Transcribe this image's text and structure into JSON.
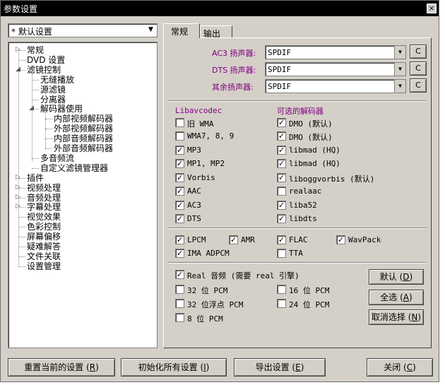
{
  "window": {
    "title": "参数设置",
    "close_glyph": "×"
  },
  "preset": {
    "value": "* 默认设置"
  },
  "tree": [
    {
      "label": "常规"
    },
    {
      "label": "DVD 设置"
    },
    {
      "label": "滤镜控制"
    },
    {
      "label": "无缝播放"
    },
    {
      "label": "源滤镜"
    },
    {
      "label": "分离器"
    },
    {
      "label": "解码器使用"
    },
    {
      "label": "内部视频解码器"
    },
    {
      "label": "外部视频解码器"
    },
    {
      "label": "内部音频解码器"
    },
    {
      "label": "外部音频解码器"
    },
    {
      "label": "多音频流"
    },
    {
      "label": "自定义滤镜管理器"
    },
    {
      "label": "插件"
    },
    {
      "label": "视频处理"
    },
    {
      "label": "音频处理"
    },
    {
      "label": "字幕处理"
    },
    {
      "label": "视觉效果"
    },
    {
      "label": "色彩控制"
    },
    {
      "label": "屏幕偏移"
    },
    {
      "label": "疑难解答"
    },
    {
      "label": "文件关联"
    },
    {
      "label": "设置管理"
    }
  ],
  "tabs": [
    {
      "label": "常规"
    },
    {
      "label": "输出"
    }
  ],
  "splitters": [
    {
      "label": "AC3 扬声器:",
      "value": "SPDIF",
      "button": "C"
    },
    {
      "label": "DTS 扬声器:",
      "value": "SPDIF",
      "button": "C"
    },
    {
      "label": "其余扬声器:",
      "value": "SPDIF",
      "button": "C"
    }
  ],
  "groups": {
    "libavcodec": "Libavcodec",
    "optional": "可选的解码器"
  },
  "left_decoders": [
    {
      "label": "旧 WMA",
      "checked": false
    },
    {
      "label": "WMA7, 8, 9",
      "checked": false
    },
    {
      "label": "MP3",
      "checked": true
    },
    {
      "label": "MP1, MP2",
      "checked": true
    },
    {
      "label": "Vorbis",
      "checked": true
    },
    {
      "label": "AAC",
      "checked": true
    },
    {
      "label": "AC3",
      "checked": true
    },
    {
      "label": "DTS",
      "checked": true
    }
  ],
  "right_decoders": [
    {
      "label": "DMO (默认)",
      "checked": true
    },
    {
      "label": "DMO (默认)",
      "checked": true
    },
    {
      "label": "libmad (HQ)",
      "checked": true
    },
    {
      "label": "libmad (HQ)",
      "checked": true
    },
    {
      "label": "liboggvorbis (默认)",
      "checked": true
    },
    {
      "label": "realaac",
      "checked": false
    },
    {
      "label": "liba52",
      "checked": true
    },
    {
      "label": "libdts",
      "checked": true
    }
  ],
  "lossless": [
    {
      "label": "LPCM",
      "checked": true
    },
    {
      "label": "AMR",
      "checked": true
    },
    {
      "label": "FLAC",
      "checked": true
    },
    {
      "label": "WavPack",
      "checked": true
    },
    {
      "label": "IMA ADPCM",
      "checked": true
    },
    {
      "label": "TTA",
      "checked": false
    }
  ],
  "misc": [
    {
      "label": "Real 音频 (需要 real 引擎)",
      "checked": true
    },
    {
      "label": "32 位 PCM",
      "checked": false
    },
    {
      "label": "16 位 PCM",
      "checked": false
    },
    {
      "label": "32 位浮点 PCM",
      "checked": false
    },
    {
      "label": "24 位 PCM",
      "checked": false
    },
    {
      "label": "8 位 PCM",
      "checked": false
    }
  ],
  "side_buttons": [
    {
      "text": "默认 (",
      "key": "D",
      "tail": ")"
    },
    {
      "text": "全选 (",
      "key": "A",
      "tail": ")"
    },
    {
      "text": "取消选择 (",
      "key": "N",
      "tail": ")"
    }
  ],
  "bottom_buttons": [
    {
      "text": "重置当前的设置 (",
      "key": "R",
      "tail": ")"
    },
    {
      "text": "初始化所有设置 (",
      "key": "I",
      "tail": ")"
    },
    {
      "text": "导出设置 (",
      "key": "E",
      "tail": ")"
    },
    {
      "text": "关闭 (",
      "key": "C",
      "tail": ")"
    }
  ],
  "check_glyph": "✓"
}
